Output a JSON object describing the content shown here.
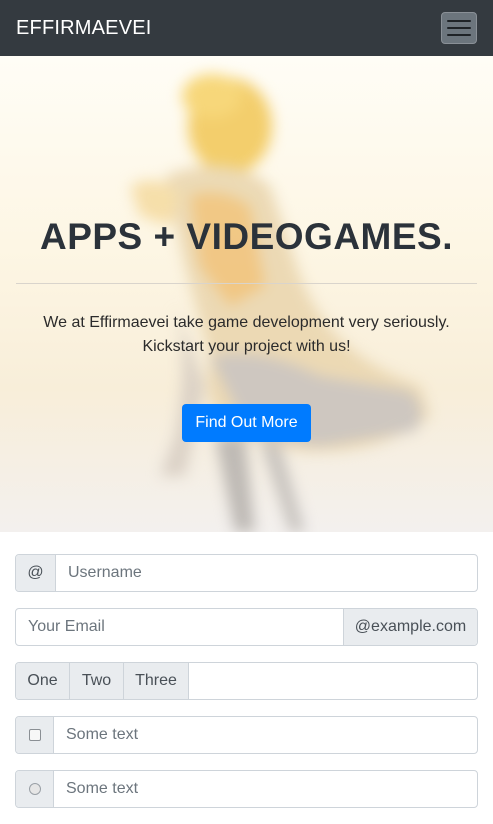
{
  "navbar": {
    "brand": "EFFIRMAEVEI"
  },
  "hero": {
    "title": "APPS + VIDEOGAMES.",
    "text_line1": "We at Effirmaevei take game development very seriously.",
    "text_line2": "Kickstart your project with us!",
    "button_label": "Find Out More"
  },
  "forms": {
    "username": {
      "prefix": "@",
      "placeholder": "Username"
    },
    "email": {
      "placeholder": "Your Email",
      "suffix": "@example.com"
    },
    "multi": {
      "addons": [
        "One",
        "Two",
        "Three"
      ]
    },
    "checkbox_row": {
      "placeholder": "Some text"
    },
    "radio_row": {
      "placeholder": "Some text"
    }
  },
  "colors": {
    "navbar_bg": "#343a40",
    "primary": "#007bff",
    "addon_bg": "#e9ecef"
  }
}
